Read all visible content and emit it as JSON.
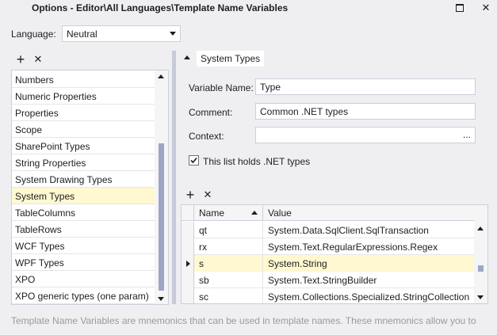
{
  "window": {
    "title": "Options - Editor\\All Languages\\Template Name Variables",
    "restore_icon": "restore-icon",
    "close_icon": "close-icon",
    "close_glyph": "✕"
  },
  "language": {
    "label": "Language:",
    "value": "Neutral"
  },
  "left_toolbar": {
    "add_glyph": "+",
    "remove_glyph": "✕"
  },
  "left_list": {
    "items": [
      "Numbers",
      "Numeric Properties",
      "Properties",
      "Scope",
      "SharePoint Types",
      "String Properties",
      "System Drawing Types",
      "System Types",
      "TableColumns",
      "TableRows",
      "WCF Types",
      "WPF Types",
      "XPO",
      "XPO generic types (one param)"
    ],
    "selected_index": 7
  },
  "section": {
    "title": "System Types"
  },
  "fields": {
    "variable_name_label": "Variable Name:",
    "variable_name_value": "Type",
    "comment_label": "Comment:",
    "comment_value": "Common .NET types",
    "context_label": "Context:",
    "context_value": "",
    "context_ellipsis": "..."
  },
  "checkbox": {
    "label": "This list holds .NET types",
    "checked": true,
    "check_glyph": "✓"
  },
  "grid_toolbar": {
    "add_glyph": "+",
    "remove_glyph": "✕"
  },
  "grid": {
    "columns": [
      "Name",
      "Value"
    ],
    "rows": [
      {
        "name": "qt",
        "value": "System.Data.SqlClient.SqlTransaction"
      },
      {
        "name": "rx",
        "value": "System.Text.RegularExpressions.Regex"
      },
      {
        "name": "s",
        "value": "System.String"
      },
      {
        "name": "sb",
        "value": "System.Text.StringBuilder"
      },
      {
        "name": "sc",
        "value": "System.Collections.Specialized.StringCollection"
      }
    ],
    "selected_index": 2
  },
  "footer": {
    "text": "Template Name Variables are mnemonics that can be used in template names. These mnemonics allow you to"
  },
  "colors": {
    "window_bg": "#EFEFF2",
    "selection": "#FFF8D0",
    "border": "#CCCEDB",
    "scroll_thumb": "#9FA6C3"
  }
}
